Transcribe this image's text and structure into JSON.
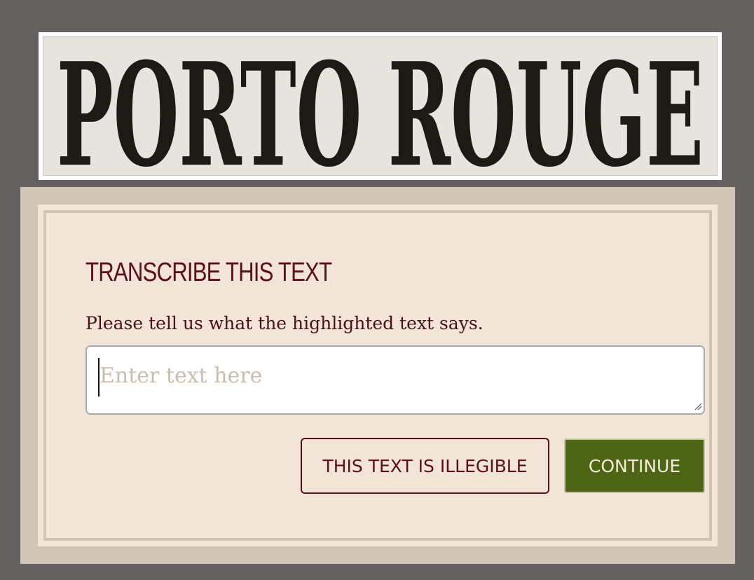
{
  "snippet": {
    "text": "PORTO ROUGE"
  },
  "task": {
    "title": "TRANSCRIBE THIS TEXT",
    "instruction": "Please tell us what the highlighted text says.",
    "input": {
      "value": "",
      "placeholder": "Enter text here"
    },
    "buttons": {
      "illegible": "THIS TEXT IS ILLEGIBLE",
      "continue": "CONTINUE"
    }
  },
  "colors": {
    "background": "#656161",
    "panel_outer": "#d2c4b6",
    "panel_inner": "#f2e4d6",
    "title": "#5a0f1b",
    "continue_button": "#4d6514"
  }
}
